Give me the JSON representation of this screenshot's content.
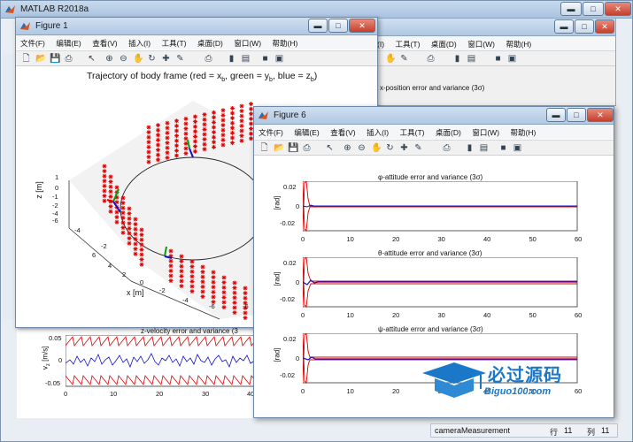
{
  "app": {
    "title": "MATLAB R2018a"
  },
  "background_figure": {
    "menu": [
      "(I)",
      "工具(T)",
      "桌面(D)",
      "窗口(W)",
      "帮助(H)"
    ],
    "plot_title": "x-position error and variance (3σ)"
  },
  "figure1": {
    "title": "Figure 1",
    "menu": [
      "文件(F)",
      "编辑(E)",
      "查看(V)",
      "插入(I)",
      "工具(T)",
      "桌面(D)",
      "窗口(W)",
      "帮助(H)"
    ],
    "plot_title": "Trajectory of body frame (red = x",
    "plot_title_parts": [
      "Trajectory of body frame (red = x",
      "b",
      ", green = y",
      "b",
      ", blue = z",
      "b",
      ")"
    ],
    "zlabel": "z [m]",
    "xlabel": "x [m]",
    "zticks": [
      "1",
      "0",
      "-1",
      "-2",
      "-3",
      "-4",
      "-5",
      "-6"
    ],
    "xticks": [
      "6",
      "4",
      "2",
      "0",
      "-2",
      "-4",
      "-6"
    ],
    "yticks_left": [
      "-4",
      "-2"
    ],
    "yticks_right": [
      "-6"
    ]
  },
  "velocity_plot": {
    "title": "z-velocity error and variance (3",
    "ylabel": "v",
    "ylabel_sub": "z",
    "ylabel_unit": "[m/s]",
    "yticks": [
      "0.05",
      "0",
      "-0.05"
    ],
    "xticks": [
      "0",
      "10",
      "20",
      "30",
      "40"
    ]
  },
  "figure6": {
    "title": "Figure 6",
    "menu": [
      "文件(F)",
      "编辑(E)",
      "查看(V)",
      "插入(I)",
      "工具(T)",
      "桌面(D)",
      "窗口(W)",
      "帮助(H)"
    ],
    "subplots": [
      {
        "title": "φ-attitude error and variance (3σ)",
        "ylabel": "[rad]"
      },
      {
        "title": "θ-attitude error and variance (3σ)",
        "ylabel": "[rad]"
      },
      {
        "title": "ψ-attitude error and variance (3σ)",
        "ylabel": "[rad]"
      }
    ],
    "yticks": [
      "0.02",
      "0",
      "-0.02"
    ],
    "xticks": [
      "0",
      "10",
      "20",
      "30",
      "40",
      "50",
      "60"
    ]
  },
  "status_bar": {
    "name": "cameraMeasurement",
    "row_label": "行",
    "row_value": "11",
    "col_label": "列",
    "col_value": "11"
  },
  "watermark": {
    "text_cn": "必过源码",
    "text_en": "Biguo100.com"
  },
  "colors": {
    "red": "#e00000",
    "blue": "#1010c8",
    "green": "#00a000",
    "accent": "#1b78c8"
  }
}
